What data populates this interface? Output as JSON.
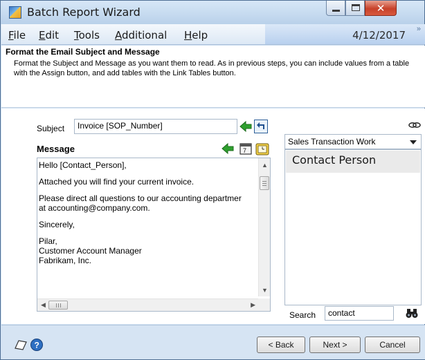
{
  "window": {
    "title": "Batch Report Wizard"
  },
  "menu": {
    "items": [
      {
        "label": "File"
      },
      {
        "label": "Edit"
      },
      {
        "label": "Tools"
      },
      {
        "label": "Additional"
      },
      {
        "label": "Help"
      }
    ],
    "date": "4/12/2017"
  },
  "header": {
    "title": "Format the Email Subject and Message",
    "description": "Format the Subject and Message as you want them to read.  As in previous steps, you can include values from a table with the Assign button, and add tables with the Link Tables button."
  },
  "subject": {
    "label": "Subject",
    "value": "Invoice [SOP_Number]"
  },
  "message": {
    "label": "Message",
    "lines": [
      "Hello [Contact_Person],",
      "",
      "Attached you will find your current invoice.",
      "",
      "Please direct all questions to our accounting departmer",
      "at accounting@company.com.",
      "",
      "Sincerely,",
      "",
      "Pilar,",
      "Customer Account Manager",
      "Fabrikam, Inc."
    ]
  },
  "table_select": {
    "value": "Sales Transaction Work"
  },
  "fields": {
    "items": [
      "Contact Person"
    ]
  },
  "search": {
    "label": "Search",
    "value": "contact"
  },
  "buttons": {
    "back": "< Back",
    "next": "Next >",
    "cancel": "Cancel"
  },
  "colors": {
    "title_bg": "#c6daf0",
    "close_red": "#c7412a",
    "arrow_green": "#2ea02e"
  }
}
